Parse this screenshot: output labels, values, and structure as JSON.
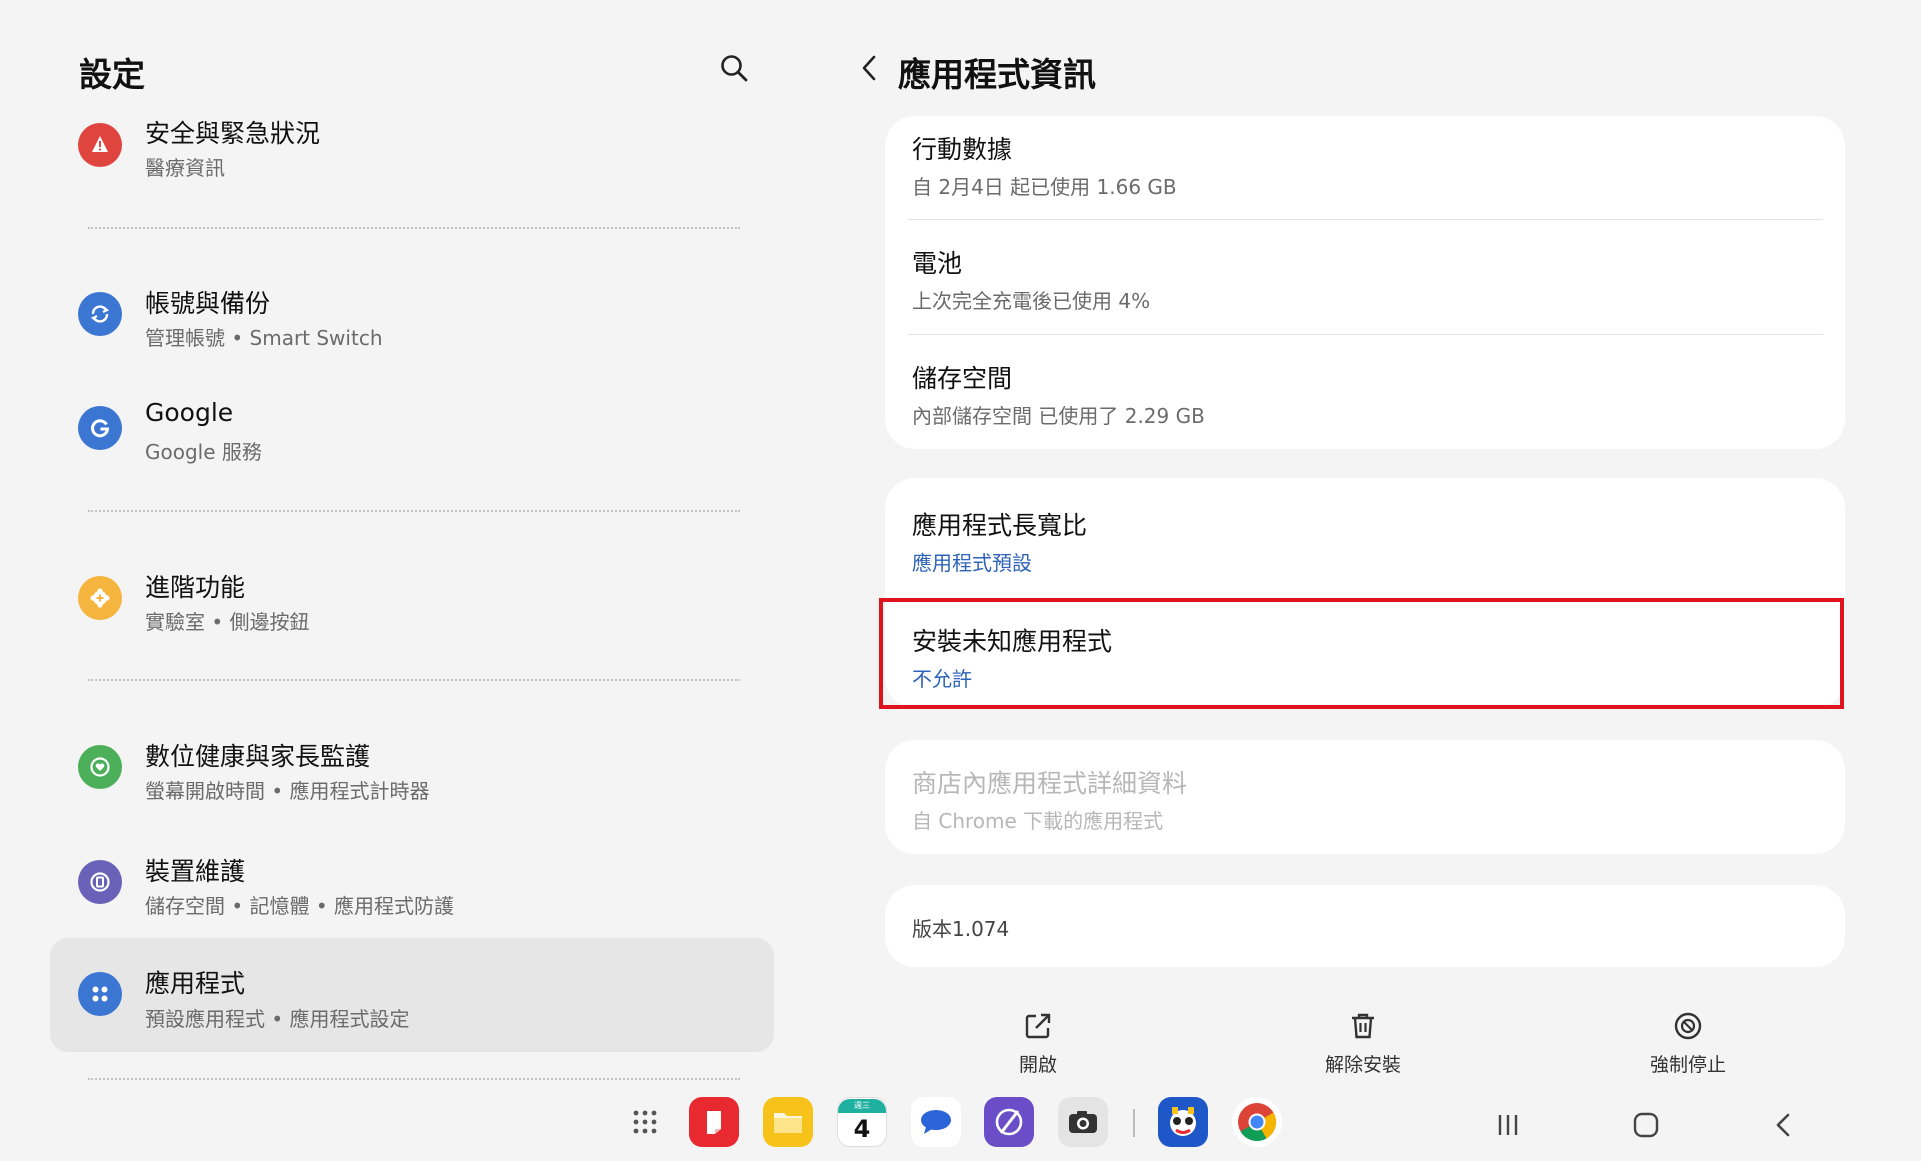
{
  "left": {
    "title": "設定",
    "items": [
      {
        "title": "安全與緊急狀況",
        "subtitle": "醫療資訊",
        "icon": "alert-icon",
        "color": "#e0443f"
      },
      {
        "title": "帳號與備份",
        "subtitle": "管理帳號 • Smart Switch",
        "icon": "sync-icon",
        "color": "#3b76d2"
      },
      {
        "title": "Google",
        "subtitle": "Google 服務",
        "icon": "google-g-icon",
        "color": "#3b76d2"
      },
      {
        "title": "進階功能",
        "subtitle": "實驗室 • 側邊按鈕",
        "icon": "gear-plus-icon",
        "color": "#f5b53f"
      },
      {
        "title": "數位健康與家長監護",
        "subtitle": "螢幕開啟時間 • 應用程式計時器",
        "icon": "heart-circle-icon",
        "color": "#4cb05a"
      },
      {
        "title": "裝置維護",
        "subtitle": "儲存空間 • 記憶體 • 應用程式防護",
        "icon": "device-care-icon",
        "color": "#6a62b8"
      },
      {
        "title": "應用程式",
        "subtitle": "預設應用程式 • 應用程式設定",
        "icon": "apps-grid-icon",
        "color": "#3b76d2"
      }
    ]
  },
  "right": {
    "title": "應用程式資訊",
    "card1": [
      {
        "title": "行動數據",
        "subtitle": "自 2月4日 起已使用 1.66 GB"
      },
      {
        "title": "電池",
        "subtitle": "上次完全充電後已使用 4%"
      },
      {
        "title": "儲存空間",
        "subtitle": "內部儲存空間 已使用了 2.29 GB"
      }
    ],
    "card2": [
      {
        "title": "應用程式長寬比",
        "subtitle": "應用程式預設"
      },
      {
        "title": "安裝未知應用程式",
        "subtitle": "不允許"
      }
    ],
    "card3": {
      "title": "商店內應用程式詳細資料",
      "subtitle": "自 Chrome 下載的應用程式"
    },
    "version": "版本1.074",
    "actions": [
      {
        "label": "開啟",
        "icon": "open-external-icon"
      },
      {
        "label": "解除安裝",
        "icon": "trash-icon"
      },
      {
        "label": "強制停止",
        "icon": "force-stop-icon"
      }
    ],
    "accent_color": "#2d63b8",
    "highlight_color": "#e0141e"
  },
  "taskbar": {
    "apps": [
      {
        "name": "app-drawer-icon"
      },
      {
        "name": "notes-app-icon",
        "color": "#e8292f"
      },
      {
        "name": "my-files-icon",
        "color": "#f7c21a"
      },
      {
        "name": "calendar-app-icon",
        "day": "4",
        "weekday": "週三",
        "color": "#1fb0a0"
      },
      {
        "name": "messages-app-icon",
        "color": "#2a64d8"
      },
      {
        "name": "internet-app-icon",
        "color": "#6b4ec7"
      },
      {
        "name": "camera-app-icon",
        "color": "#cfcfcf"
      },
      {
        "name": "game-app-icon",
        "color": "#1e57c8"
      },
      {
        "name": "chrome-app-icon"
      }
    ],
    "nav": [
      "recents-button",
      "home-button",
      "back-button"
    ]
  }
}
